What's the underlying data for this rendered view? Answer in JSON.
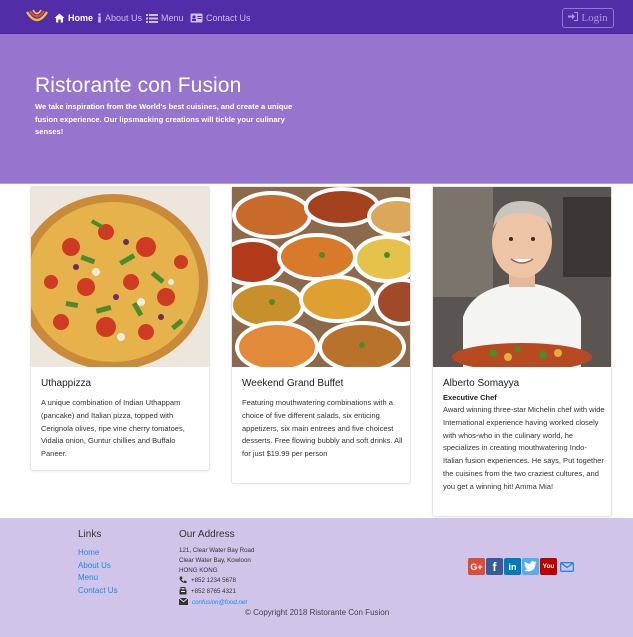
{
  "nav": {
    "items": [
      {
        "label": "Home",
        "icon": "home-icon",
        "active": true
      },
      {
        "label": "About Us",
        "icon": "info-icon",
        "active": false
      },
      {
        "label": "Menu",
        "icon": "list-icon",
        "active": false
      },
      {
        "label": "Contact Us",
        "icon": "address-card-icon",
        "active": false
      }
    ],
    "login_label": "Login"
  },
  "jumbotron": {
    "title": "Ristorante con Fusion",
    "text": "We take inspiration from the World's best cuisines, and create a unique fusion experience. Our lipsmacking creations will tickle your culinary senses!"
  },
  "cards": [
    {
      "title": "Uthappizza",
      "subtitle": "",
      "text": "A unique combination of Indian Uthappam (pancake) and Italian pizza, topped with Cerignola olives, ripe vine cherry tomatoes, Vidalia onion, Guntur chillies and Buffalo Paneer."
    },
    {
      "title": "Weekend Grand Buffet",
      "subtitle": "",
      "text": "Featuring mouthwatering combinations with a choice of five different salads, six enticing appetizers, six main entrees and five choicest desserts. Free flowing bubbly and soft drinks. All for just $19.99 per person"
    },
    {
      "title": "Alberto Somayya",
      "subtitle": "Executive Chef",
      "text": "Award winning three-star Michelin chef with wide International experience having worked closely with whos-who in the culinary world, he specializes in creating mouthwatering Indo-Italian fusion experiences. He says, Put together the cuisines from the two craziest cultures, and you get a winning hit! Amma Mia!"
    }
  ],
  "footer": {
    "links_heading": "Links",
    "links": [
      "Home",
      "About Us",
      "Menu",
      "Contact Us"
    ],
    "address_heading": "Our Address",
    "address_lines": [
      "121, Clear Water Bay Road",
      "Clear Water Bay, Kowloon",
      "HONG KONG"
    ],
    "phone": "+852 1234 5678",
    "fax": "+852 8765 4321",
    "email": "confusion@food.net",
    "social": [
      {
        "icon": "google-plus-icon",
        "glyph": "G+",
        "color": "#dd4b39"
      },
      {
        "icon": "facebook-icon",
        "glyph": "f",
        "color": "#3b5998"
      },
      {
        "icon": "linkedin-icon",
        "glyph": "in",
        "color": "#007bb6"
      },
      {
        "icon": "twitter-icon",
        "glyph": "t",
        "color": "#55acee"
      },
      {
        "icon": "youtube-icon",
        "glyph": "You",
        "color": "#bb0000"
      },
      {
        "icon": "envelope-icon",
        "glyph": "",
        "color": "#1e88e5"
      }
    ],
    "copyright": "© Copyright 2018 Ristorante Con Fusion"
  },
  "colors": {
    "navbar": "#512DA8",
    "jumbotron": "#9575CD",
    "footer": "#D1C4E9",
    "link": "#1e88e5"
  }
}
